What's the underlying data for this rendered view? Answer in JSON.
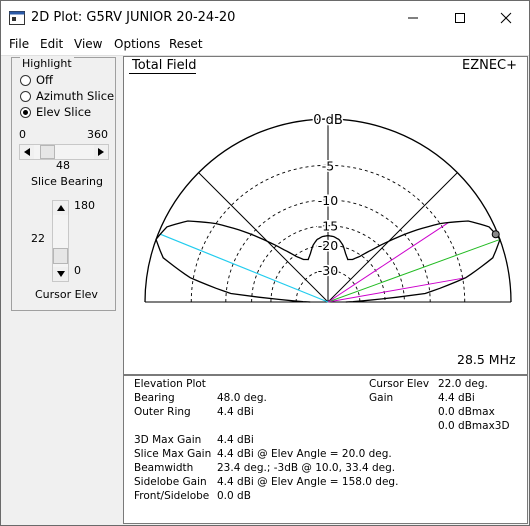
{
  "window": {
    "title": "2D Plot: G5RV JUNIOR 20-24-20"
  },
  "menu": [
    "File",
    "Edit",
    "View",
    "Options",
    "Reset"
  ],
  "highlight": {
    "label": "Highlight",
    "options": [
      {
        "label": "Off",
        "selected": false
      },
      {
        "label": "Azimuth Slice",
        "selected": false
      },
      {
        "label": "Elev Slice",
        "selected": true
      }
    ]
  },
  "slice_bearing": {
    "min_label": "0",
    "max_label": "360",
    "value": "48",
    "label": "Slice Bearing",
    "fraction": 0.1333
  },
  "cursor_elev": {
    "max_label": "180",
    "min_label": "0",
    "value": "22",
    "label": "Cursor Elev",
    "fraction": 0.1222
  },
  "plot": {
    "title": "Total Field",
    "brand": "EZNEC+",
    "frequency": "28.5 MHz",
    "ring_labels": [
      "0 dB",
      "-5",
      "-10",
      "-15",
      "-20",
      "-30"
    ]
  },
  "chart_data": {
    "type": "polar-elevation",
    "title": "Total Field",
    "ring_labels": [
      "0 dB",
      "-5",
      "-10",
      "-15",
      "-20",
      "-30"
    ],
    "scale": "ARRL log",
    "elevation_deg": [
      0,
      5,
      10,
      15,
      20,
      25,
      30,
      35,
      40,
      45,
      50,
      55,
      60,
      65,
      70,
      75,
      80,
      85,
      90
    ],
    "gain_db_front": [
      -40,
      -10.8,
      -4.6,
      -1.2,
      0.0,
      -0.5,
      -2.1,
      -5.0,
      -8.8,
      -13.0,
      -17.0,
      -20.4,
      -22.6,
      -23.4,
      -21.8,
      -19.6,
      -18.2,
      -17.6,
      -17.4
    ],
    "gain_db_back": [
      -40,
      -10.8,
      -4.6,
      -1.2,
      0.0,
      -0.5,
      -2.1,
      -5.0,
      -8.8,
      -13.0,
      -17.0,
      -20.4,
      -22.6,
      -23.4,
      -21.8,
      -19.6,
      -18.2,
      -17.6,
      -17.4
    ],
    "cursor_elev_deg": 22,
    "highlight_lines_deg": [
      10,
      20,
      33.4
    ],
    "cursor_line_deg": 158
  },
  "info": {
    "rows_left": [
      {
        "label": "Elevation Plot",
        "value": ""
      },
      {
        "label": "Bearing",
        "value": "48.0 deg."
      },
      {
        "label": "Outer Ring",
        "value": "4.4 dBi"
      },
      {
        "label": "",
        "value": ""
      },
      {
        "label": "3D Max Gain",
        "value": "4.4 dBi"
      },
      {
        "label": "Slice Max Gain",
        "value": "4.4 dBi @ Elev Angle = 20.0 deg."
      },
      {
        "label": "Beamwidth",
        "value": "23.4 deg.; -3dB @ 10.0, 33.4 deg."
      },
      {
        "label": "Sidelobe Gain",
        "value": "4.4 dBi @ Elev Angle = 158.0 deg."
      },
      {
        "label": "Front/Sidelobe",
        "value": "0.0 dB"
      }
    ],
    "rows_right": [
      {
        "label": "Cursor Elev",
        "value": "22.0 deg."
      },
      {
        "label": "Gain",
        "value": "4.4 dBi"
      },
      {
        "label": "",
        "value": "0.0 dBmax"
      },
      {
        "label": "",
        "value": "0.0 dBmax3D"
      }
    ]
  }
}
